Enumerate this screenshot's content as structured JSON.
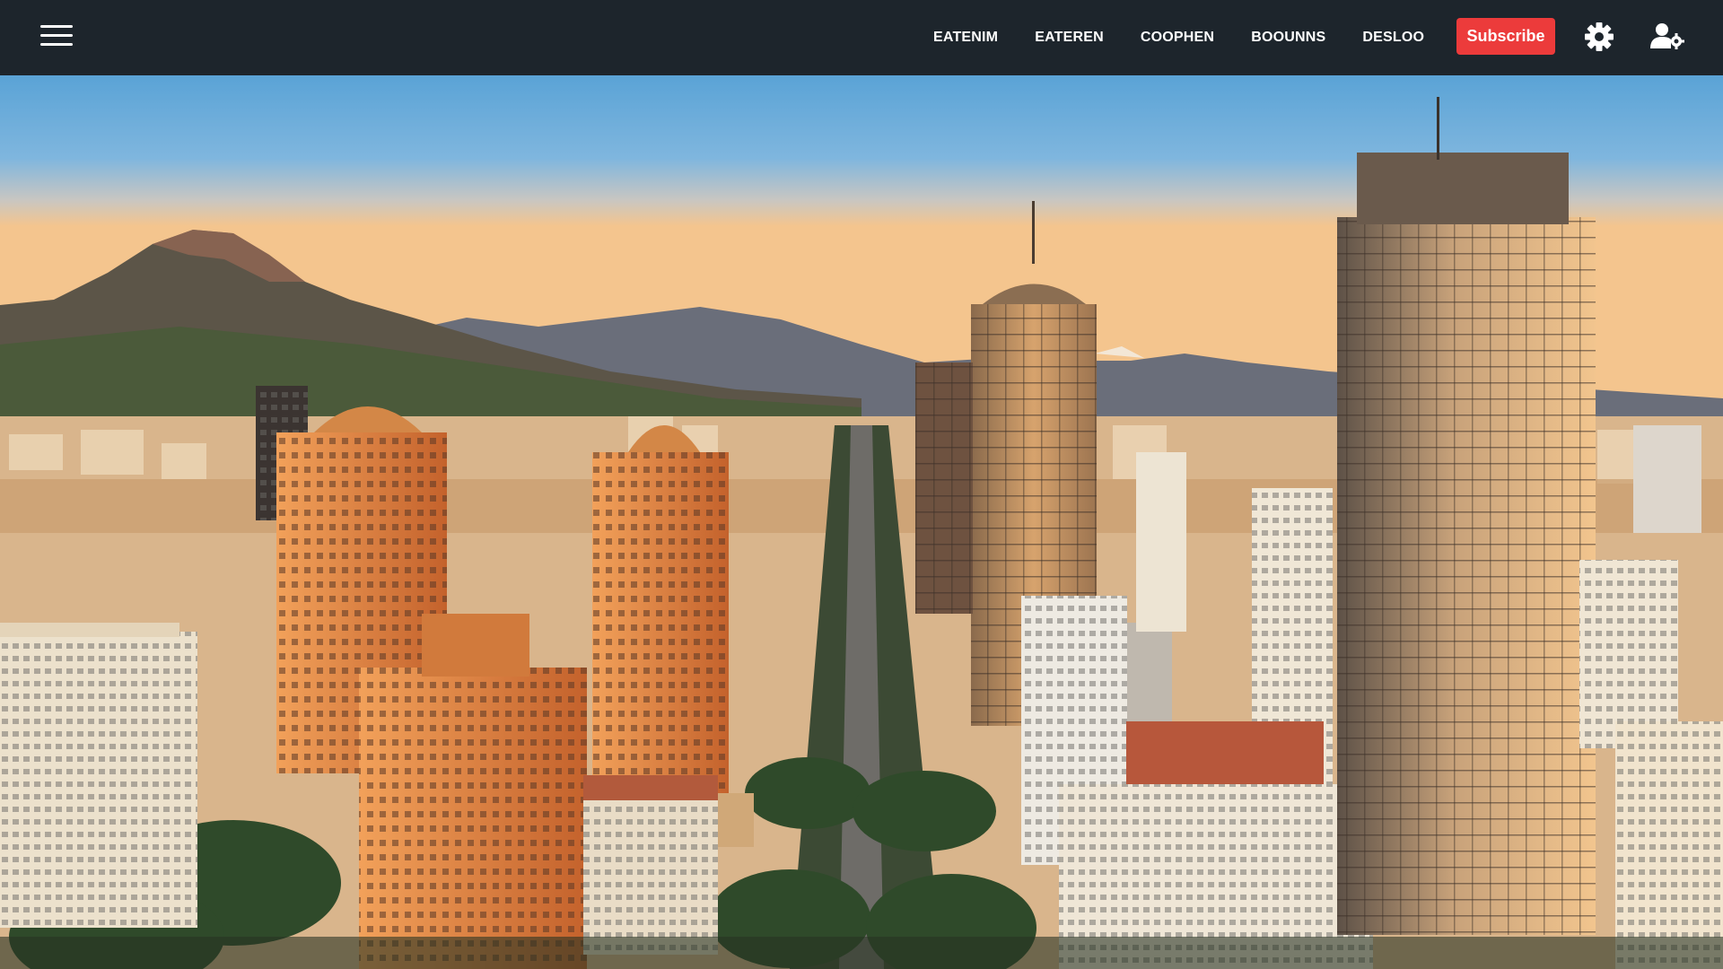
{
  "header": {
    "menu_icon": "hamburger-menu-icon",
    "nav_items": [
      "EATENIM",
      "EATEREN",
      "COOPHEN",
      "BOOUNNS",
      "DESLOO"
    ],
    "subscribe_label": "Subscribe",
    "settings_icon": "gear-icon",
    "user_icon": "user-settings-icon"
  },
  "hero": {
    "image_subject": "aerial-city-skyline-at-sunset"
  },
  "colors": {
    "topbar": "#1d252c",
    "subscribe": "#ec3b3b",
    "sky_top": "#5aa3d6",
    "sky_horizon": "#f4c58e",
    "building_lit": "#e88a43"
  }
}
